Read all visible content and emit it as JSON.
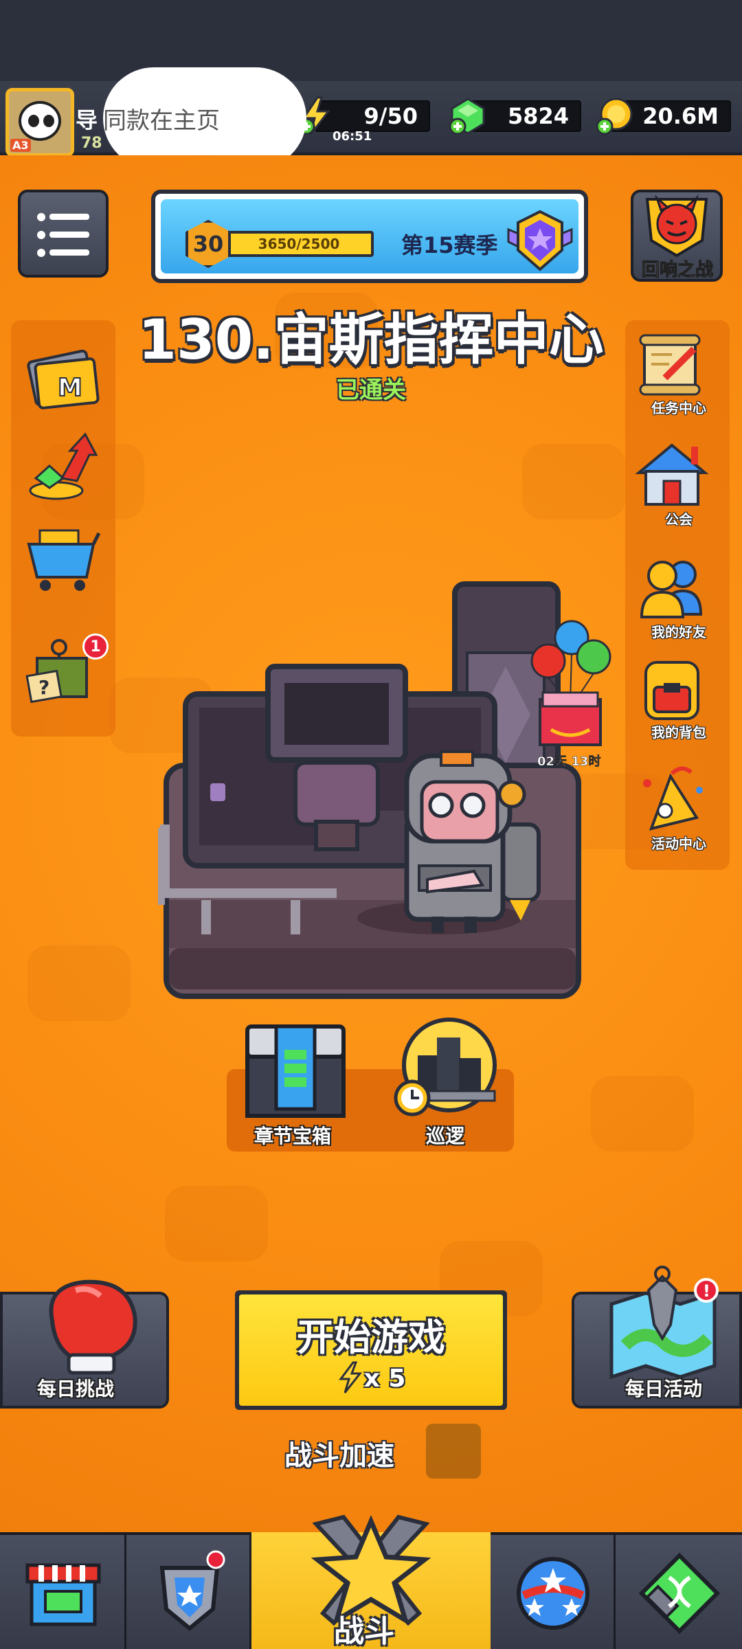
{
  "header": {
    "player_name": "导",
    "player_level": "78",
    "avatar_rank": "A3",
    "toast": "同款在主页",
    "energy": "9/50",
    "energy_timer": "06:51",
    "gems": "5824",
    "gold": "20.6M"
  },
  "season": {
    "level": "30",
    "progress": "3650/2500",
    "label": "第15赛季"
  },
  "echo_battle": {
    "label": "回响之战"
  },
  "stage": {
    "title": "130.宙斯指挥中心",
    "status": "已通关"
  },
  "left_menu": {
    "mystery_crate_badge": "1"
  },
  "right_menu": [
    {
      "label": "任务中心",
      "icon": "scroll-icon"
    },
    {
      "label": "公会",
      "icon": "guild-house-icon"
    },
    {
      "label": "我的好友",
      "icon": "friends-icon"
    },
    {
      "label": "我的背包",
      "icon": "backpack-icon"
    },
    {
      "label": "活动中心",
      "icon": "party-horn-icon"
    }
  ],
  "gift": {
    "timer": "02天 13时"
  },
  "chest_panel": {
    "chapter_chest": "章节宝箱",
    "patrol": "巡逻"
  },
  "bottom": {
    "daily_challenge": "每日挑战",
    "daily_event": "每日活动",
    "start_game": "开始游戏",
    "start_cost": "x 5",
    "speed_label": "战斗加速"
  },
  "nav": {
    "battle": "战斗"
  },
  "colors": {
    "background": "#fa8d12",
    "accent_yellow": "#ffd23a",
    "dark": "#2a2e3a"
  }
}
